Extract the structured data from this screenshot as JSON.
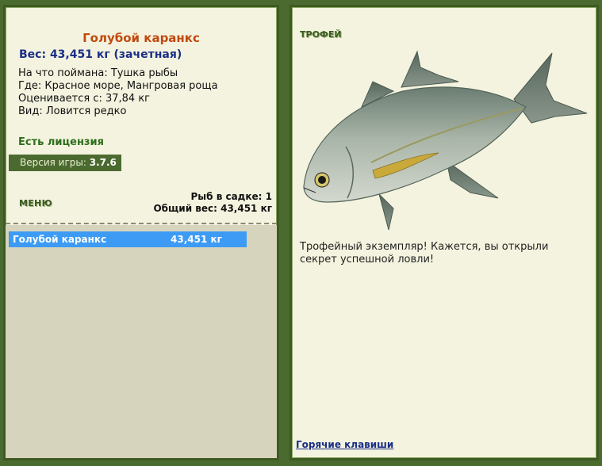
{
  "left": {
    "fish_name": "Голубой каранкс",
    "weight_line": "Вес: 43,451 кг (зачетная)",
    "bait_line": "На что поймана: Тушка рыбы",
    "where_line": "Где: Красное море, Мангровая роща",
    "value_line": "Оценивается с: 37,84 кг",
    "kind_line": "Вид: Ловится редко",
    "license": "Есть лицензия",
    "version_label": "Версия игры:",
    "version_value": "3.7.6",
    "menu_label": "МЕНЮ",
    "cage_count_line": "Рыб в садке: 1",
    "total_weight_line": "Общий вес: 43,451 кг"
  },
  "cage": {
    "items": [
      {
        "name": "Голубой каранкс",
        "weight": "43,451 кг"
      }
    ]
  },
  "right": {
    "trophy_label": "ТРОФЕЙ",
    "trophy_text": "Трофейный экземпляр! Кажется, вы открыли секрет успешной ловли!",
    "hotkeys_link": "Горячие клавиши"
  },
  "colors": {
    "frame": "#4b6a2f",
    "panel": "#f4f3df",
    "selection": "#3d9bf5",
    "title": "#c04a10",
    "weight": "#1a2f86"
  }
}
